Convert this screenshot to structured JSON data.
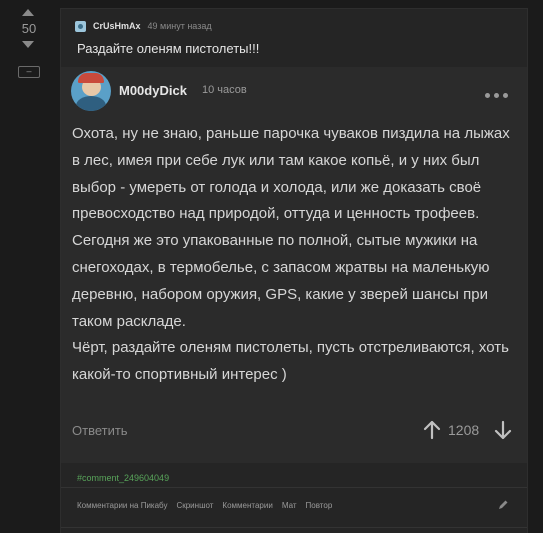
{
  "vote": {
    "score": "50",
    "collapse_label": "–"
  },
  "parent": {
    "author": "CrUsHmAx",
    "time": "49 минут назад",
    "text": "Раздайте оленям пистолеты!!!"
  },
  "comment": {
    "author": "M00dyDick",
    "time": "10 часов",
    "body": "Охота, ну не знаю, раньше парочка чуваков пиздила на лыжах в лес, имея при себе лук или там какое копьё, и у них был выбор - умереть от голода и холода, или же доказать своё превосходство над природой, оттуда и ценность трофеев.\nСегодня же это упакованные по полной, сытые мужики на снегоходах, в термобелье, с запасом жратвы на маленькую деревню, набором оружия, GPS, какие у зверей шансы при таком раскладе.\nЧёрт, раздайте оленям пистолеты, пусть отстреливаются, хоть какой-то спортивный интерес )",
    "reply_label": "Ответить",
    "rating": "1208"
  },
  "hash_link": "#comment_249604049",
  "footer": {
    "links": [
      "Комментарии на Пикабу",
      "Скриншот",
      "Комментарии",
      "Мат",
      "Повтор"
    ]
  },
  "colors": {
    "background": "#1b1b1b",
    "panel": "#252525",
    "comment_panel": "#2b2b2b",
    "link_green": "#58a45a"
  },
  "icons": [
    "vote-up-icon",
    "vote-down-icon",
    "more-dots-icon",
    "arrow-up-icon",
    "arrow-down-icon",
    "pencil-icon"
  ]
}
